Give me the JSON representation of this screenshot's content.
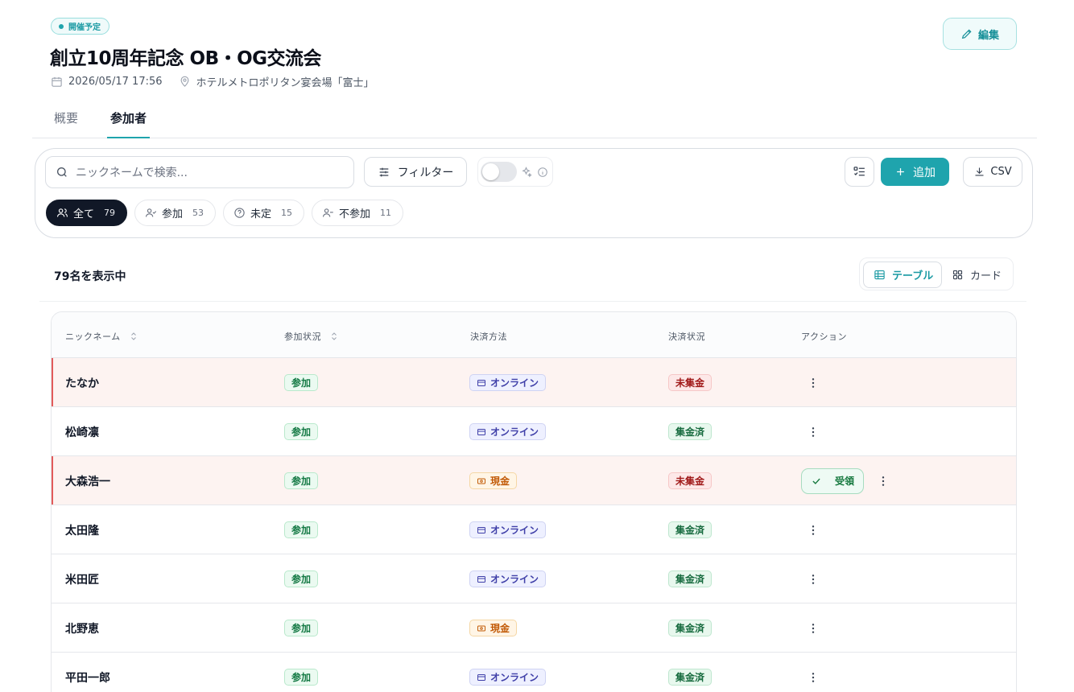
{
  "event": {
    "status": "開催予定",
    "title": "創立10周年記念 OB・OG交流会",
    "datetime": "2026/05/17 17:56",
    "location": "ホテルメトロポリタン宴会場「富士」",
    "edit_label": "編集"
  },
  "tabs": [
    "概要",
    "参加者"
  ],
  "toolbar": {
    "search_placeholder": "ニックネームで検索...",
    "filter_label": "フィルター",
    "add_label": "追加",
    "csv_label": "CSV"
  },
  "chips": [
    {
      "label": "全て",
      "count": "79"
    },
    {
      "label": "参加",
      "count": "53"
    },
    {
      "label": "未定",
      "count": "15"
    },
    {
      "label": "不参加",
      "count": "11"
    }
  ],
  "result_count": "79名を表示中",
  "view_modes": {
    "table": "テーブル",
    "card": "カード"
  },
  "table": {
    "headers": [
      "ニックネーム",
      "参加状況",
      "決済方法",
      "決済状況",
      "アクション"
    ],
    "rows": [
      {
        "name": "たなか",
        "attendance": "参加",
        "method": "オンライン",
        "payment": "未集金"
      },
      {
        "name": "松崎凛",
        "attendance": "参加",
        "method": "オンライン",
        "payment": "集金済"
      },
      {
        "name": "大森浩一",
        "attendance": "参加",
        "method": "現金",
        "payment": "未集金",
        "action": "受領"
      },
      {
        "name": "太田隆",
        "attendance": "参加",
        "method": "オンライン",
        "payment": "集金済"
      },
      {
        "name": "米田匠",
        "attendance": "参加",
        "method": "オンライン",
        "payment": "集金済"
      },
      {
        "name": "北野恵",
        "attendance": "参加",
        "method": "現金",
        "payment": "集金済"
      },
      {
        "name": "平田一郎",
        "attendance": "参加",
        "method": "オンライン",
        "payment": "集金済"
      }
    ]
  },
  "colors": {
    "accent": "#1fa4ad",
    "dark": "#111827",
    "alert": "#e25a5a"
  }
}
